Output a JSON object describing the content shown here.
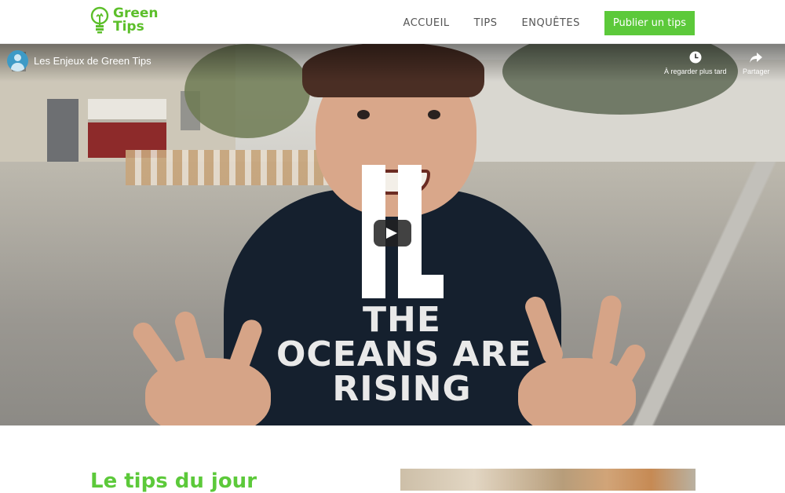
{
  "header": {
    "logo": {
      "line1": "Green",
      "line2": "Tips"
    },
    "nav": [
      {
        "label": "ACCUEIL"
      },
      {
        "label": "TIPS"
      },
      {
        "label": "ENQUÊTES"
      }
    ],
    "cta_label": "Publier un tips"
  },
  "video": {
    "title": "Les Enjeux de Green Tips",
    "watch_later_label": "À regarder plus tard",
    "share_label": "Partager",
    "shirt_lines": [
      "THE",
      "OCEANS ARE",
      "RISING"
    ],
    "overlay_letters": "IL"
  },
  "section": {
    "title": "Le tips du jour"
  },
  "colors": {
    "brand_green": "#5cc93a",
    "logo_green": "#5cbf2a"
  }
}
